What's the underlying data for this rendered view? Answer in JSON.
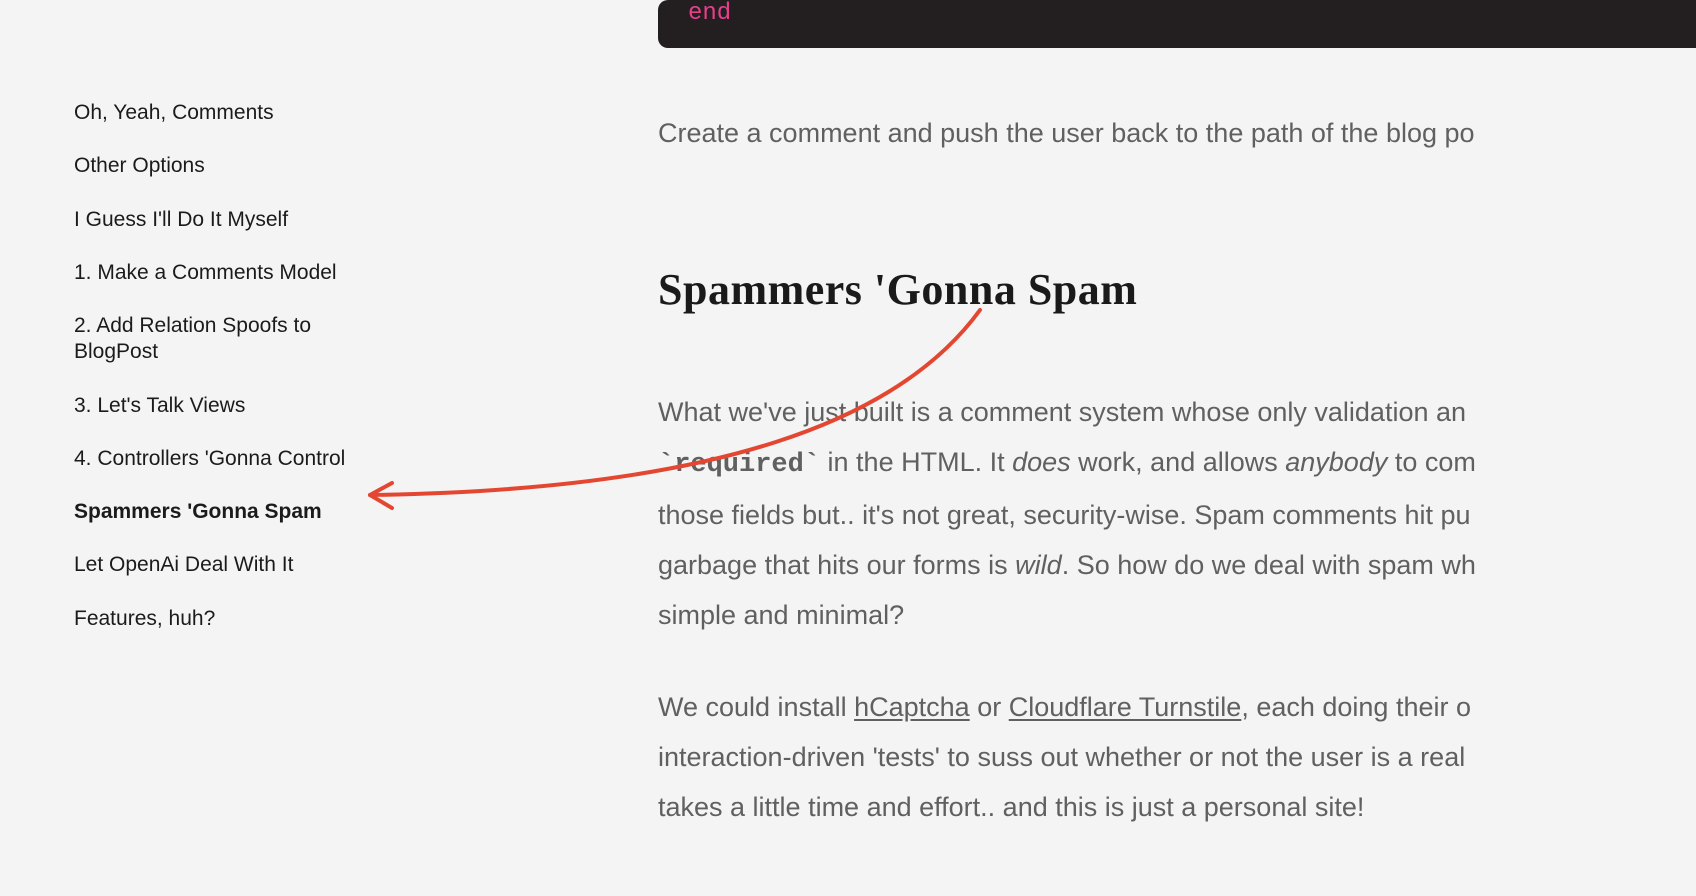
{
  "toc": {
    "items": [
      {
        "label": "Oh, Yeah, Comments",
        "active": false
      },
      {
        "label": "Other Options",
        "active": false
      },
      {
        "label": "I Guess I'll Do It Myself",
        "active": false
      },
      {
        "label": "1. Make a Comments Model",
        "active": false
      },
      {
        "label": "2. Add Relation Spoofs to BlogPost",
        "active": false
      },
      {
        "label": "3. Let's Talk Views",
        "active": false
      },
      {
        "label": "4. Controllers 'Gonna Control",
        "active": false
      },
      {
        "label": "Spammers 'Gonna Spam",
        "active": true
      },
      {
        "label": "Let OpenAi Deal With It",
        "active": false
      },
      {
        "label": "Features, huh?",
        "active": false
      }
    ]
  },
  "code": {
    "snippet": "end"
  },
  "article": {
    "lead": "Create a comment and push the user back to the path of the blog po",
    "heading": "Spammers 'Gonna Spam",
    "p1_a": "What we've just built is a comment system whose only validation an",
    "p1_code": "`required`",
    "p1_b": " in the HTML. It ",
    "p1_em1": "does",
    "p1_c": " work, and allows ",
    "p1_em2": "anybody",
    "p1_d": " to com",
    "p1_e": "those fields but.. it's not great, security-wise. Spam comments hit pu",
    "p1_f": "garbage that hits our forms is ",
    "p1_em3": "wild",
    "p1_g": ". So how do we deal with spam wh",
    "p1_h": "simple and minimal?",
    "p2_a": "We could install ",
    "p2_link1": "hCaptcha",
    "p2_b": " or ",
    "p2_link2": "Cloudflare Turnstile",
    "p2_c": ", each doing their o",
    "p2_d": "interaction-driven 'tests' to suss out whether or not the user is a real",
    "p2_e": "takes a little time and effort.. and this is just a personal site!"
  },
  "colors": {
    "accent": "#e44731",
    "code_bg": "#231f20",
    "code_fg": "#e83e8c",
    "body_text": "#606060"
  }
}
